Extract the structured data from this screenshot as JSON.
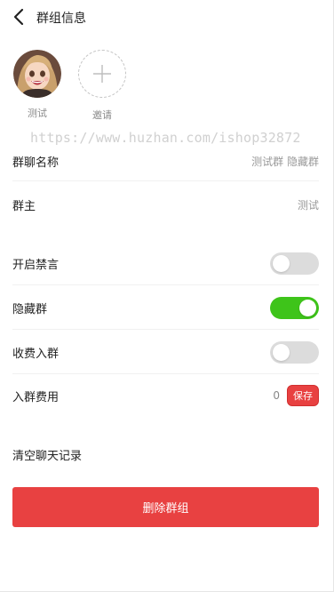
{
  "header": {
    "title": "群组信息"
  },
  "members": [
    {
      "name": "测试"
    }
  ],
  "invite": {
    "label": "邀请"
  },
  "watermark": "https://www.huzhan.com/ishop32872",
  "info_rows": {
    "group_name": {
      "label": "群聊名称",
      "value": "测试群 隐藏群"
    },
    "owner": {
      "label": "群主",
      "value": "测试"
    }
  },
  "settings": {
    "mute": {
      "label": "开启禁言",
      "on": false
    },
    "hidden": {
      "label": "隐藏群",
      "on": true
    },
    "paid_join": {
      "label": "收费入群",
      "on": false
    }
  },
  "fee": {
    "label": "入群费用",
    "value": "0",
    "save_label": "保存"
  },
  "clear_history": {
    "label": "清空聊天记录"
  },
  "delete_group": {
    "label": "删除群组"
  },
  "colors": {
    "accent_red": "#e84141",
    "toggle_on": "#3ec41a",
    "toggle_off": "#dcdcdc"
  }
}
